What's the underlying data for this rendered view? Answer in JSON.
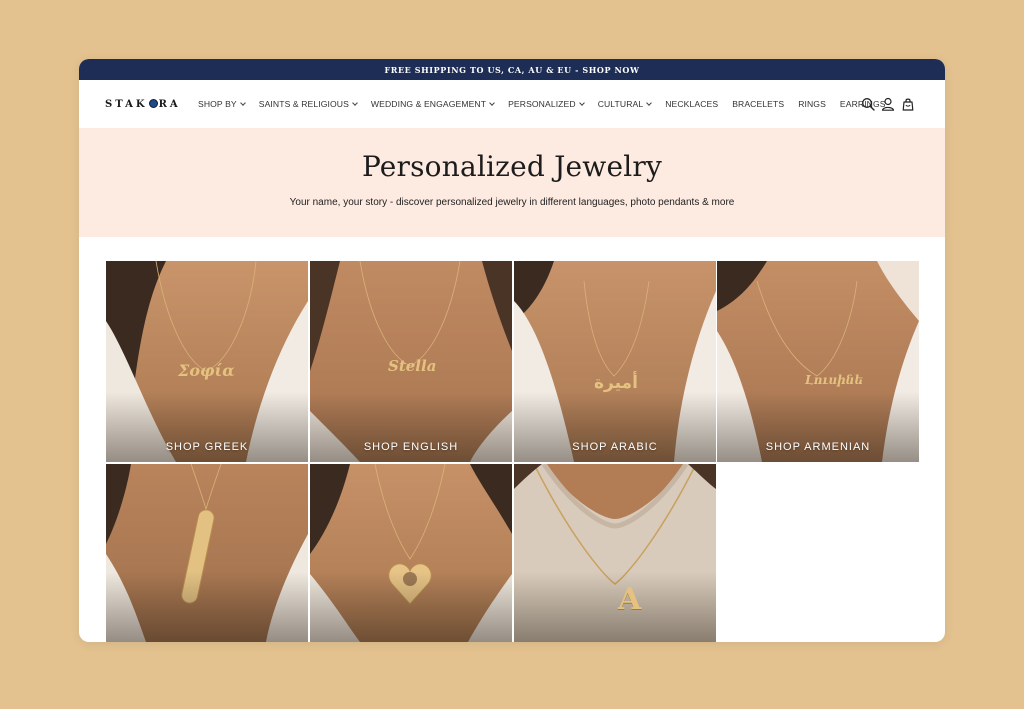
{
  "announcement": "FREE SHIPPING TO US, CA, AU & EU - SHOP NOW",
  "brand": {
    "pre": "STAK",
    "post": "RA"
  },
  "nav": [
    {
      "label": "SHOP BY",
      "dropdown": true
    },
    {
      "label": "SAINTS & RELIGIOUS",
      "dropdown": true
    },
    {
      "label": "WEDDING & ENGAGEMENT",
      "dropdown": true
    },
    {
      "label": "PERSONALIZED",
      "dropdown": true
    },
    {
      "label": "CULTURAL",
      "dropdown": true
    },
    {
      "label": "NECKLACES",
      "dropdown": false
    },
    {
      "label": "BRACELETS",
      "dropdown": false
    },
    {
      "label": "RINGS",
      "dropdown": false
    },
    {
      "label": "EARRINGS",
      "dropdown": false
    }
  ],
  "header_icons": [
    "search-icon",
    "account-icon",
    "cart-icon"
  ],
  "hero": {
    "title": "Personalized Jewelry",
    "subtitle": "Your name, your story - discover personalized jewelry in different languages, photo pendants & more"
  },
  "collections": [
    {
      "label": "SHOP GREEK",
      "pendant": "Σοφία"
    },
    {
      "label": "SHOP ENGLISH",
      "pendant": "Stella"
    },
    {
      "label": "SHOP ARABIC",
      "pendant": "أميرة"
    },
    {
      "label": "SHOP ARMENIAN",
      "pendant": "Լուսինե"
    },
    {
      "label": "",
      "pendant": ""
    },
    {
      "label": "",
      "pendant": ""
    },
    {
      "label": "",
      "pendant": "A"
    }
  ],
  "colors": {
    "accent": "#1d2d55",
    "hero_bg": "#fdeae0",
    "page_bg": "#e3c28f",
    "gold": "#d9b27a"
  }
}
